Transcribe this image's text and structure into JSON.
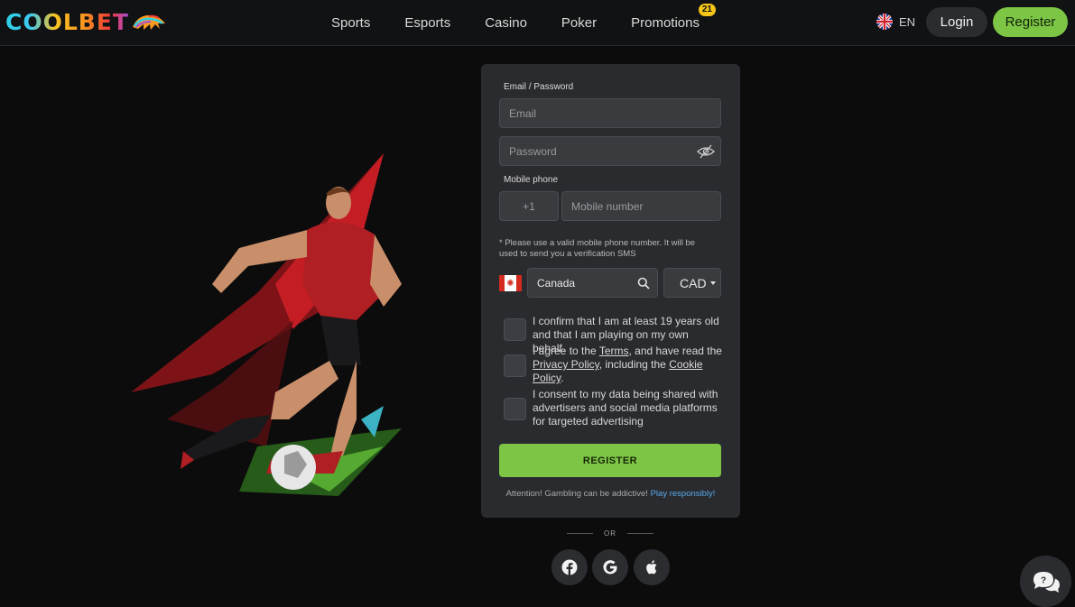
{
  "header": {
    "logo_text": "COOLBET",
    "nav": [
      {
        "label": "Sports"
      },
      {
        "label": "Esports"
      },
      {
        "label": "Casino"
      },
      {
        "label": "Poker"
      },
      {
        "label": "Promotions",
        "badge": "21"
      }
    ],
    "language": "EN",
    "login_label": "Login",
    "register_label": "Register"
  },
  "form": {
    "email_password_label": "Email / Password",
    "email_placeholder": "Email",
    "password_placeholder": "Password",
    "mobile_label": "Mobile phone",
    "phone_code": "+1",
    "mobile_placeholder": "Mobile number",
    "phone_hint": "* Please use a valid mobile phone number. It will be used to send you a verification SMS",
    "country": "Canada",
    "currency": "CAD",
    "checks": [
      {
        "text": "I confirm that I am at least 19 years old and that I am playing on my own behalf."
      },
      {
        "pre": "I agree to the ",
        "terms": "Terms",
        "mid": ", and have read the ",
        "privacy": "Privacy Policy",
        "mid2": ", including the ",
        "cookie": "Cookie Policy",
        "end": "."
      },
      {
        "text": "I consent to my data being shared with advertisers and social media platforms for targeted advertising"
      }
    ],
    "submit_label": "REGISTER",
    "attention_text": "Attention! Gambling can be addictive!",
    "attention_link": "Play responsibly!"
  },
  "alt_login": {
    "or_text": "OR",
    "providers": [
      "facebook-icon",
      "google-icon",
      "apple-icon"
    ]
  },
  "colors": {
    "accent_green": "#7cc545",
    "panel_bg": "#2a2b2e",
    "page_bg": "#0c0c0d",
    "link_blue": "#59a8e8"
  }
}
